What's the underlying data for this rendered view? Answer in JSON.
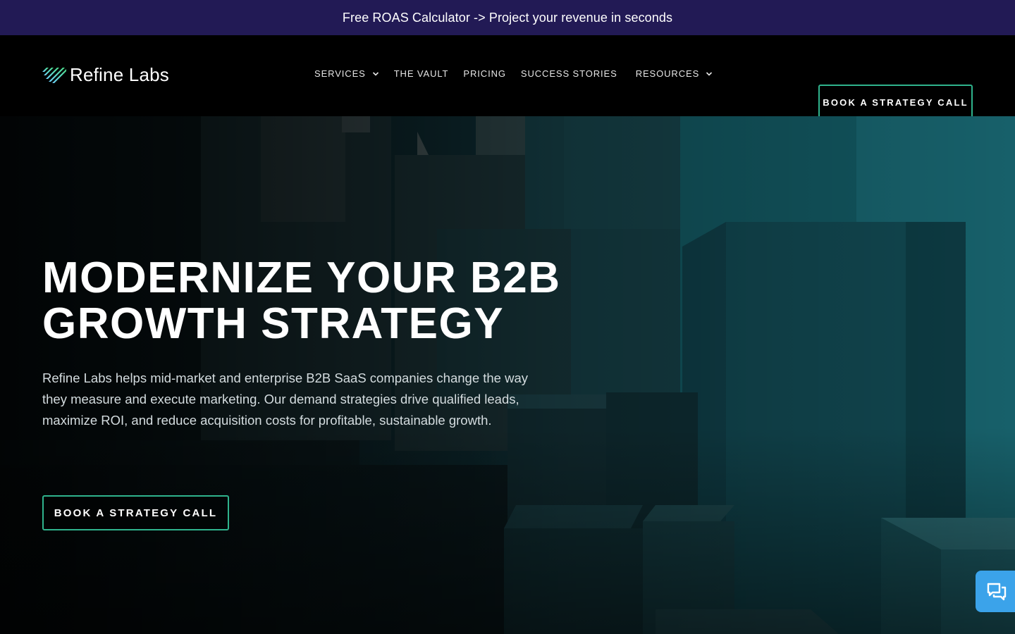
{
  "announcement": {
    "text": "Free ROAS Calculator -> Project your revenue in seconds"
  },
  "header": {
    "logo_text": "Refine Labs",
    "nav": [
      {
        "label": "SERVICES",
        "has_dropdown": true
      },
      {
        "label": "THE VAULT",
        "has_dropdown": false
      },
      {
        "label": "PRICING",
        "has_dropdown": false
      },
      {
        "label": "SUCCESS STORIES",
        "has_dropdown": false
      },
      {
        "label": "RESOURCES",
        "has_dropdown": true
      }
    ],
    "cta_label": "BOOK A STRATEGY CALL"
  },
  "hero": {
    "title_line1": "MODERNIZE YOUR B2B",
    "title_line2": "GROWTH STRATEGY",
    "description": "Refine Labs helps mid-market and enterprise B2B SaaS companies change the way they measure and execute marketing. Our demand strategies drive qualified leads, maximize ROI, and reduce acquisition costs for profitable, sustainable growth.",
    "cta_label": "BOOK A STRATEGY CALL"
  },
  "chat": {
    "icon": "chat-bubbles-icon"
  },
  "colors": {
    "announcement_bg": "#221a55",
    "accent_green": "#2fb38d",
    "hero_teal": "#0f4a55",
    "chat_blue": "#3ba3ea"
  }
}
